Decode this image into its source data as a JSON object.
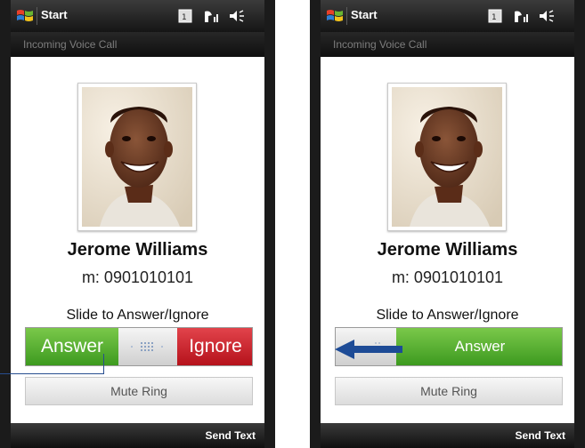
{
  "phones": [
    {
      "start_label": "Start",
      "subtitle": "Incoming Voice Call",
      "caller_name": "Jerome Williams",
      "caller_number": "m: 0901010101",
      "slide_label": "Slide to Answer/Ignore",
      "slider_answer": "Answer",
      "slider_ignore": "Ignore",
      "mute_label": "Mute Ring",
      "bottom_action": "Send Text",
      "status_icons": [
        "calendar-icon",
        "signal-icon",
        "speaker-icon"
      ]
    },
    {
      "start_label": "Start",
      "subtitle": "Incoming Voice Call",
      "caller_name": "Jerome Williams",
      "caller_number": "m: 0901010101",
      "slide_label": "Slide to Answer/Ignore",
      "slider_answer": "Answer",
      "mute_label": "Mute Ring",
      "bottom_action": "Send Text",
      "status_icons": [
        "calendar-icon",
        "signal-icon",
        "speaker-icon"
      ]
    }
  ],
  "colors": {
    "answer_green": "#4fa82a",
    "ignore_red": "#c61a22",
    "annotation_blue": "#1d4b96"
  }
}
